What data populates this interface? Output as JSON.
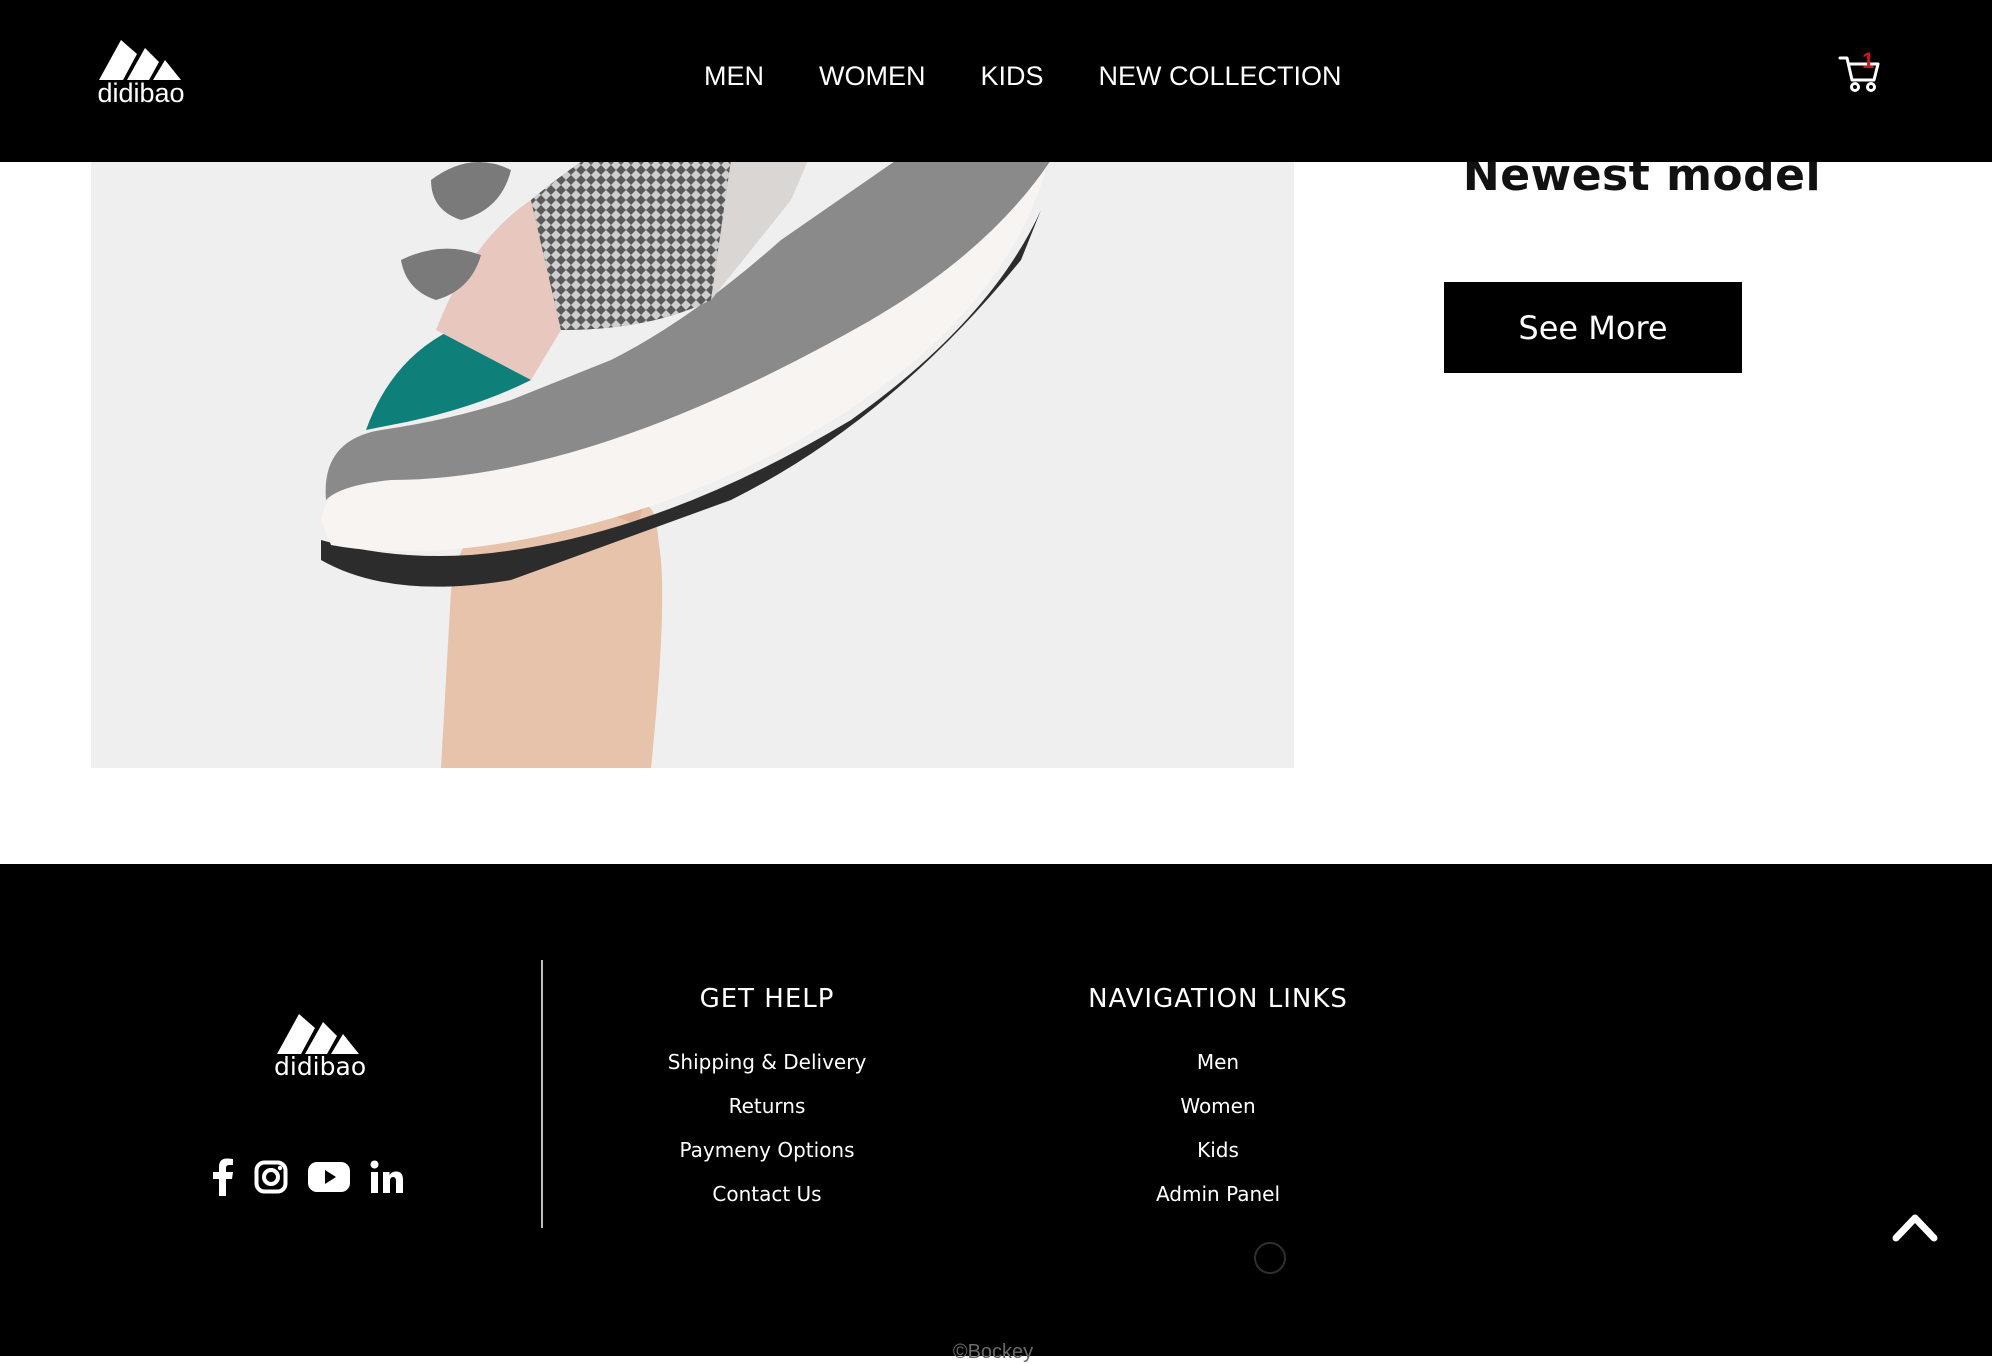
{
  "header": {
    "brand_name": "didibao",
    "nav": [
      {
        "label": "MEN"
      },
      {
        "label": "WOMEN"
      },
      {
        "label": "KIDS"
      },
      {
        "label": "NEW COLLECTION"
      }
    ],
    "cart": {
      "icon": "cart-icon",
      "count": "1"
    }
  },
  "hero": {
    "image": "sneaker-held-in-hand-photo",
    "title": "Newest model",
    "cta_label": "See More"
  },
  "footer": {
    "brand_name": "didibao",
    "social": [
      {
        "icon": "facebook-icon"
      },
      {
        "icon": "instagram-icon"
      },
      {
        "icon": "youtube-icon"
      },
      {
        "icon": "linkedin-icon"
      }
    ],
    "get_help": {
      "heading": "GET HELP",
      "links": [
        {
          "label": "Shipping & Delivery"
        },
        {
          "label": "Returns"
        },
        {
          "label": "Paymeny Options"
        },
        {
          "label": "Contact Us"
        }
      ]
    },
    "navigation": {
      "heading": "NAVIGATION LINKS",
      "links": [
        {
          "label": "Men"
        },
        {
          "label": "Women"
        },
        {
          "label": "Kids"
        },
        {
          "label": "Admin Panel"
        }
      ]
    },
    "back_to_top_icon": "chevron-up-icon",
    "copyright": "©Bockey"
  },
  "colors": {
    "header_bg": "#000000",
    "footer_bg": "#000000",
    "button_bg": "#000000",
    "cart_badge": "#d11414",
    "accent_teal": "#0f7f7a"
  }
}
